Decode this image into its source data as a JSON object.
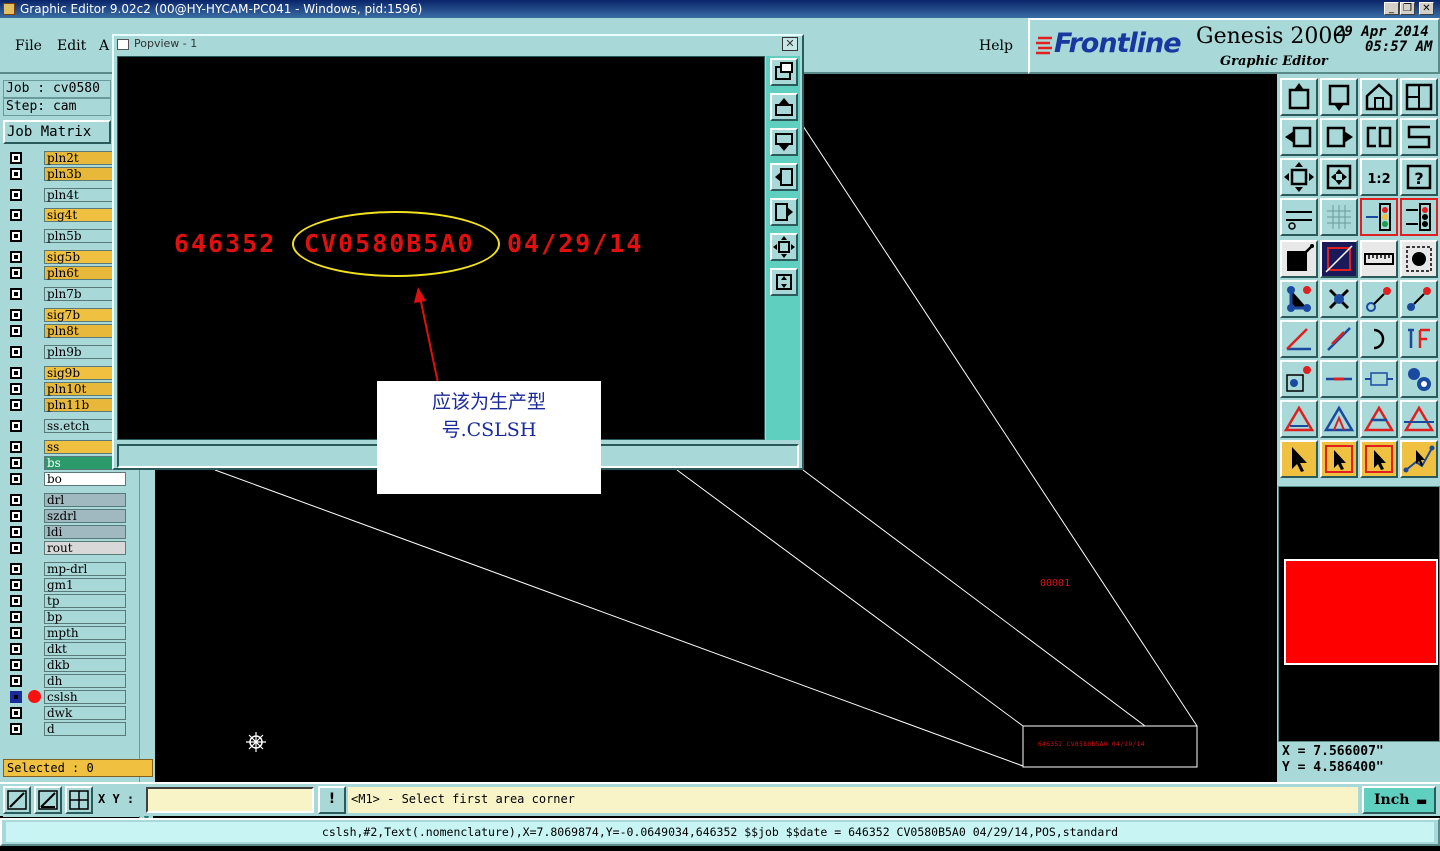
{
  "window": {
    "title": "Graphic Editor 9.02c2 (00@HY-HYCAM-PC041 - Windows, pid:1596)",
    "min_glyph": "_",
    "max_glyph": "❐",
    "close_glyph": "✕"
  },
  "menu": {
    "file": "File",
    "edit": "Edit",
    "actions_partial": "A",
    "help": "Help"
  },
  "brand": {
    "logo": "Frontline",
    "product": "Genesis 2000",
    "subtitle": "Graphic Editor",
    "date": "29 Apr 2014",
    "time": "05:57 AM"
  },
  "info": {
    "job": "Job : cv0580",
    "step": "Step: cam",
    "job_matrix": "Job Matrix"
  },
  "layers": [
    {
      "name": "pln2t",
      "color": "#e8b83a"
    },
    {
      "name": "pln3b",
      "color": "#e8b83a"
    },
    {
      "name": "pln4t",
      "color": "#a8d8d8"
    },
    {
      "name": "sig4t",
      "color": "#f0c040"
    },
    {
      "name": "pln5b",
      "color": "#a8d8d8"
    },
    {
      "name": "sig5b",
      "color": "#f0c040"
    },
    {
      "name": "pln6t",
      "color": "#e8b83a"
    },
    {
      "name": "pln7b",
      "color": "#a8d8d8"
    },
    {
      "name": "sig7b",
      "color": "#f0c040"
    },
    {
      "name": "pln8t",
      "color": "#e8b83a"
    },
    {
      "name": "pln9b",
      "color": "#a8d8d8"
    },
    {
      "name": "sig9b",
      "color": "#f0c040"
    },
    {
      "name": "pln10t",
      "color": "#e8b83a"
    },
    {
      "name": "pln11b",
      "color": "#e8b83a"
    },
    {
      "name": "ss.etch",
      "color": "#a8d8d8"
    },
    {
      "name": "ss",
      "color": "#f0c040"
    },
    {
      "name": "bs",
      "color": "#2a9a6a"
    },
    {
      "name": "bo",
      "color": "#ffffff"
    },
    {
      "name": "drl",
      "color": "#a0b8c0"
    },
    {
      "name": "szdrl",
      "color": "#a0b8c0"
    },
    {
      "name": "ldi",
      "color": "#a0b8c0"
    },
    {
      "name": "rout",
      "color": "#d8d8d8"
    },
    {
      "name": "mp-drl",
      "color": "#a8d8d8"
    },
    {
      "name": "gm1",
      "color": "#a8d8d8"
    },
    {
      "name": "tp",
      "color": "#a8d8d8"
    },
    {
      "name": "bp",
      "color": "#a8d8d8"
    },
    {
      "name": "mpth",
      "color": "#a8d8d8"
    },
    {
      "name": "dkt",
      "color": "#a8d8d8"
    },
    {
      "name": "dkb",
      "color": "#a8d8d8"
    },
    {
      "name": "dh",
      "color": "#a8d8d8"
    },
    {
      "name": "cslsh",
      "color": "#a8d8d8",
      "active": true
    },
    {
      "name": "dwk",
      "color": "#a8d8d8"
    },
    {
      "name": "d",
      "color": "#a8d8d8"
    }
  ],
  "selected": "Selected : 0",
  "popview": {
    "title": "Popview - 1",
    "text_left": "646352",
    "text_mid": "CV0580B5A0",
    "text_right": "04/29/14",
    "note_line1": "应该为生产型",
    "note_line2": "号.CSLSH"
  },
  "canvas": {
    "small_label": "00001",
    "inset_text": "646352 CV0580B5A0 04/29/14"
  },
  "coords": {
    "x": "X = 7.566007\"",
    "y": "Y = 4.586400\""
  },
  "command": {
    "xy_label": "X Y :",
    "xy_value": "",
    "excl": "!",
    "prompt": "<M1> - Select first area corner",
    "units": "Inch"
  },
  "status": "cslsh,#2,Text(.nomenclature),X=7.8069874,Y=-0.0649034,646352 $$job $$date = 646352 CV0580B5A0 04/29/14,POS,standard",
  "colors": {
    "panel": "#a8d8d8",
    "accent": "#5fcfc0",
    "feature_red": "#ff1010",
    "highlight": "#f0e020"
  }
}
